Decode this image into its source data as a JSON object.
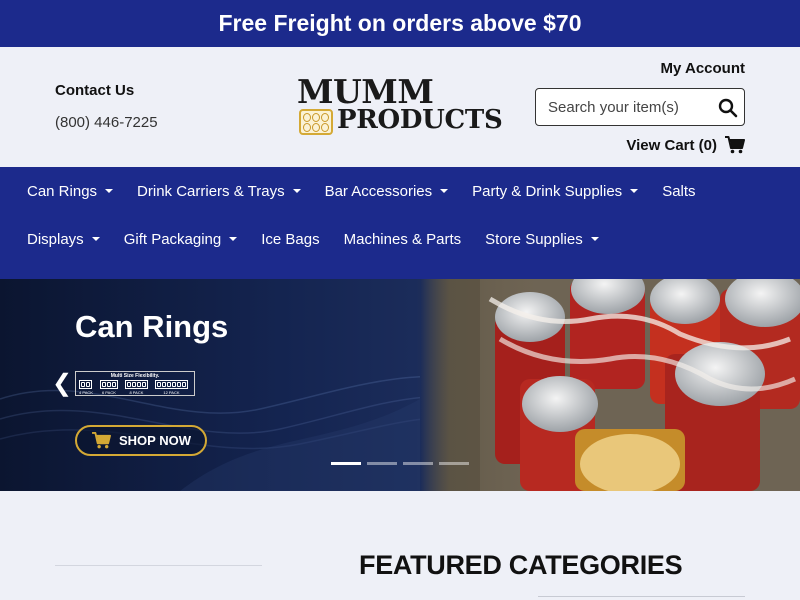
{
  "promo": {
    "text": "Free Freight on orders above $70"
  },
  "header": {
    "contact_title": "Contact Us",
    "contact_phone": "(800) 446-7225",
    "logo_line1": "MUMM",
    "logo_line2": "PRODUCTS",
    "account_label": "My Account",
    "search_placeholder": "Search your item(s)",
    "cart_label": "View Cart (0)"
  },
  "nav": {
    "row1": [
      {
        "label": "Can Rings",
        "has_dropdown": true
      },
      {
        "label": "Drink Carriers & Trays",
        "has_dropdown": true
      },
      {
        "label": "Bar Accessories",
        "has_dropdown": true
      },
      {
        "label": "Party & Drink Supplies",
        "has_dropdown": true
      },
      {
        "label": "Salts",
        "has_dropdown": false
      }
    ],
    "row2": [
      {
        "label": "Displays",
        "has_dropdown": true
      },
      {
        "label": "Gift Packaging",
        "has_dropdown": true
      },
      {
        "label": "Ice Bags",
        "has_dropdown": false
      },
      {
        "label": "Machines & Parts",
        "has_dropdown": false
      },
      {
        "label": "Store Supplies",
        "has_dropdown": true
      }
    ]
  },
  "hero": {
    "title": "Can Rings",
    "tagline": "Multi Size Flexibility.",
    "packs": [
      "4 PACK",
      "6 PACK",
      "8 PACK",
      "12 PACK"
    ],
    "cta_label": "SHOP NOW",
    "active_slide": 1,
    "slide_count": 4
  },
  "featured": {
    "title": "FEATURED CATEGORIES"
  },
  "colors": {
    "brand_navy": "#1c2a8c",
    "accent_gold": "#d4a935",
    "page_bg": "#eef0f7"
  }
}
